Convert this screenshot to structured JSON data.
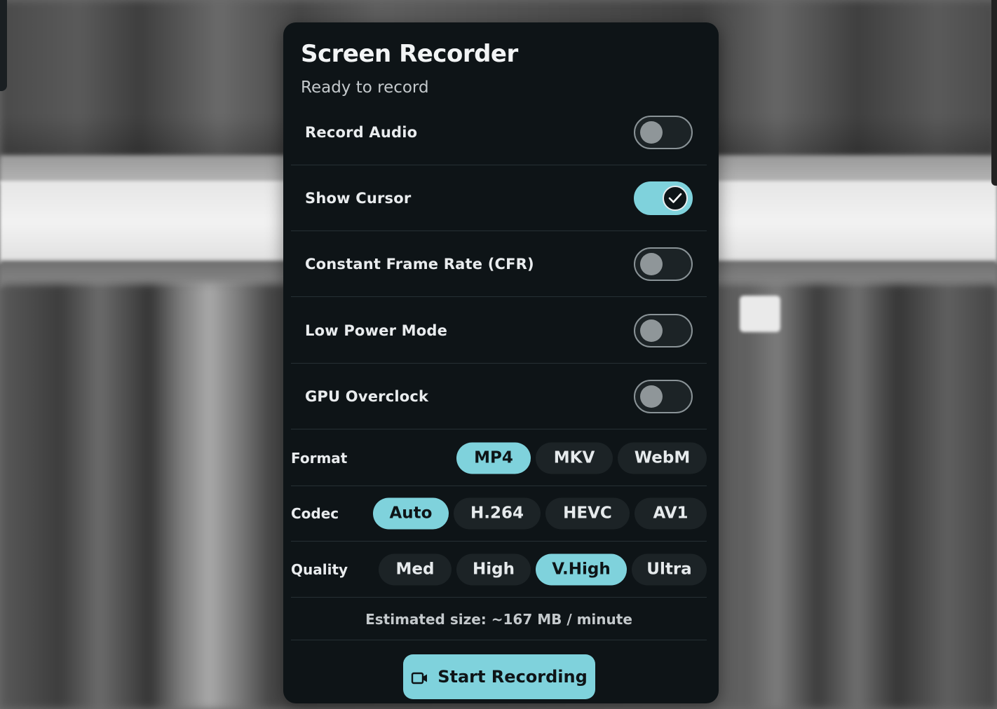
{
  "panel": {
    "title": "Screen Recorder",
    "status": "Ready to record"
  },
  "toggles": [
    {
      "label": "Record Audio",
      "on": false
    },
    {
      "label": "Show Cursor",
      "on": true
    },
    {
      "label": "Constant Frame Rate (CFR)",
      "on": false
    },
    {
      "label": "Low Power Mode",
      "on": false
    },
    {
      "label": "GPU Overclock",
      "on": false
    }
  ],
  "format": {
    "label": "Format",
    "options": [
      "MP4",
      "MKV",
      "WebM"
    ],
    "selected": "MP4"
  },
  "codec": {
    "label": "Codec",
    "options": [
      "Auto",
      "H.264",
      "HEVC",
      "AV1"
    ],
    "selected": "Auto"
  },
  "quality": {
    "label": "Quality",
    "options": [
      "Med",
      "High",
      "V.High",
      "Ultra"
    ],
    "selected": "V.High"
  },
  "estimate": "Estimated size: ~167 MB / minute",
  "start_button": {
    "label": "Start Recording",
    "icon": "video-camera-icon"
  },
  "colors": {
    "accent": "#7fd2dc",
    "panel_bg": "#0e1417",
    "control_bg": "#1c2326"
  }
}
